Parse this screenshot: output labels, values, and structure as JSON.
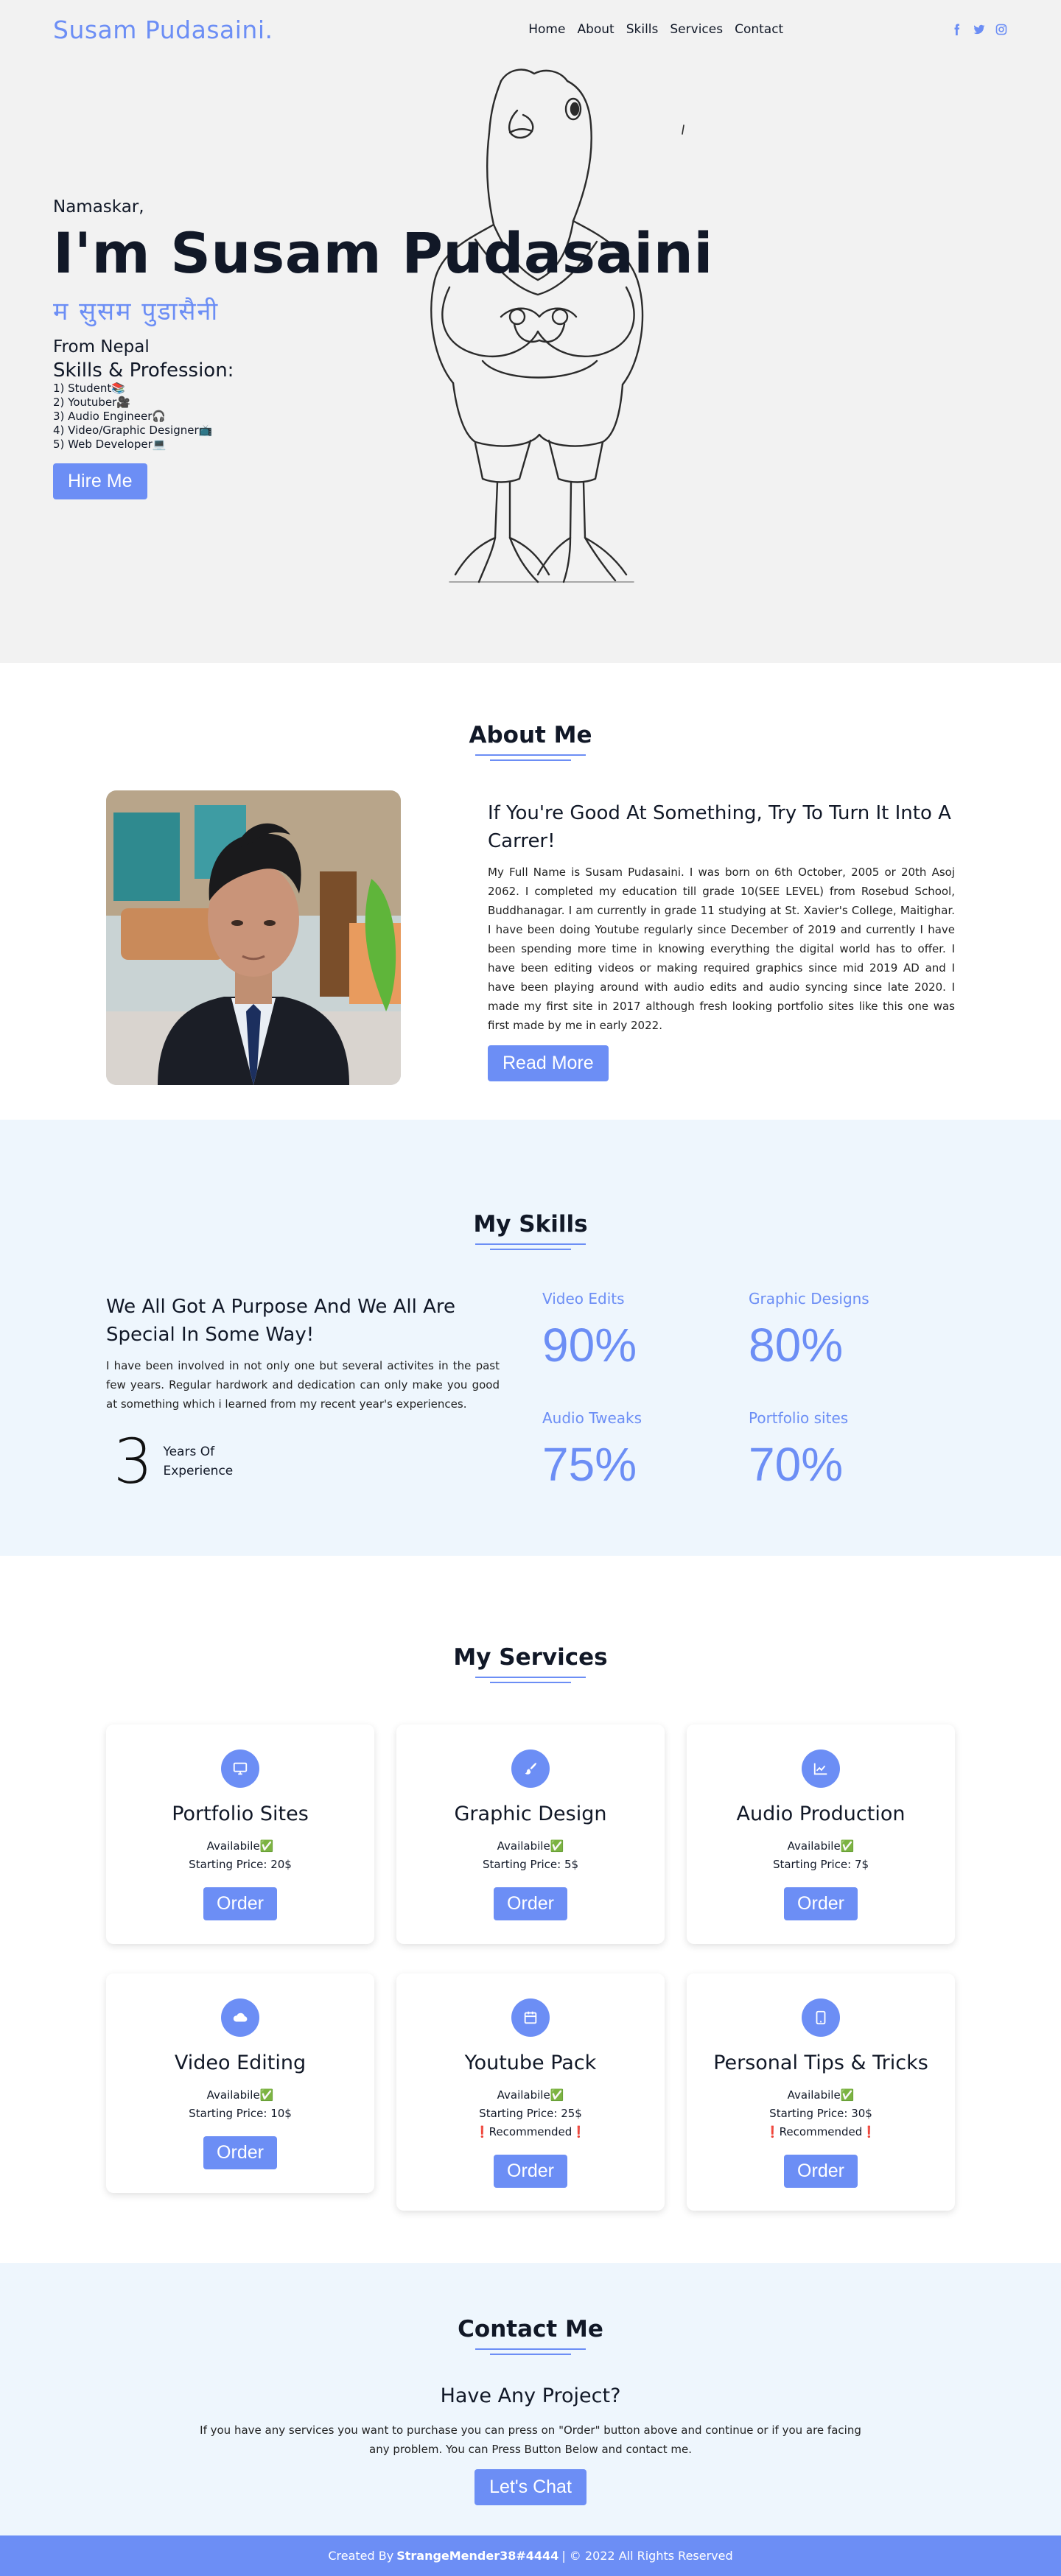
{
  "header": {
    "logo": "Susam Pudasaini.",
    "nav": [
      "Home",
      "About",
      "Skills",
      "Services",
      "Contact"
    ],
    "social_icons": [
      "facebook-icon",
      "twitter-icon",
      "instagram-icon"
    ]
  },
  "hero": {
    "greeting": "Namaskar,",
    "name": "I'm Susam Pudasaini",
    "nepali_name": "म सुसम पुडासैनी",
    "from": "From Nepal",
    "skills_title": "Skills & Profession:",
    "skills": [
      "1) Student📚",
      "2) Youtuber🎥",
      "3) Audio Engineer🎧",
      "4) Video/Graphic Designer📺",
      "5) Web Developer💻"
    ],
    "hire_label": "Hire Me"
  },
  "about": {
    "title": "About Me",
    "heading": "If You're Good At Something, Try To Turn It Into A Carrer!",
    "text": "My Full Name is Susam Pudasaini. I was born on 6th October, 2005 or 20th Asoj 2062. I completed my education till grade 10(SEE LEVEL) from Rosebud School, Buddhanagar. I am currently in grade 11 studying at St. Xavier's College, Maitighar. I have been doing Youtube regularly since December of 2019 and currently I have been spending more time in knowing everything the digital world has to offer. I have been editing videos or making required graphics since mid 2019 AD and I have been playing around with audio edits and audio syncing since late 2020. I made my first site in 2017 although fresh looking portfolio sites like this one was first made by me in early 2022.",
    "read_more": "Read More"
  },
  "skills": {
    "title": "My Skills",
    "heading": "We All Got A Purpose And We All Are Special In Some Way!",
    "text": "I have been involved in not only one but several activites in the past few years. Regular hardwork and dedication can only make you good at something which i learned from my recent year's experiences.",
    "experience_number": "3",
    "experience_label": "Years Of Experience",
    "items": [
      {
        "name": "Video Edits",
        "percent": "90%"
      },
      {
        "name": "Graphic Designs",
        "percent": "80%"
      },
      {
        "name": "Audio Tweaks",
        "percent": "75%"
      },
      {
        "name": "Portfolio sites",
        "percent": "70%"
      }
    ]
  },
  "services": {
    "title": "My Services",
    "order_label": "Order",
    "cards": [
      {
        "title": "Portfolio Sites",
        "available": "Availabile✅",
        "price": "Starting Price: 20$",
        "recommended": "",
        "icon": "desktop-icon"
      },
      {
        "title": "Graphic Design",
        "available": "Availabile✅",
        "price": "Starting Price: 5$",
        "recommended": "",
        "icon": "brush-icon"
      },
      {
        "title": "Audio Production",
        "available": "Availabile✅",
        "price": "Starting Price: 7$",
        "recommended": "",
        "icon": "chart-line-icon"
      },
      {
        "title": "Video Editing",
        "available": "Availabile✅",
        "price": "Starting Price: 10$",
        "recommended": "",
        "icon": "cloud-icon"
      },
      {
        "title": "Youtube Pack",
        "available": "Availabile✅",
        "price": "Starting Price: 25$",
        "recommended": "❗Recommended❗",
        "icon": "calendar-icon"
      },
      {
        "title": "Personal Tips & Tricks",
        "available": "Availabile✅",
        "price": "Starting Price: 30$",
        "recommended": "❗Recommended❗",
        "icon": "tablet-icon"
      }
    ]
  },
  "contact": {
    "title": "Contact Me",
    "heading": "Have Any Project?",
    "text": "If you have any services you want to purchase you can press on \"Order\" button above and continue or if you are facing any problem. You can Press Button Below and contact me.",
    "chat_label": "Let's Chat"
  },
  "footer": {
    "prefix": "Created By",
    "author": "StrangeMender38#4444",
    "suffix": "| © 2022 All Rights Reserved"
  },
  "colors": {
    "accent": "#6c8ef5",
    "hero_bg": "#f2f2f2",
    "section_alt_bg": "#eef6fd"
  }
}
